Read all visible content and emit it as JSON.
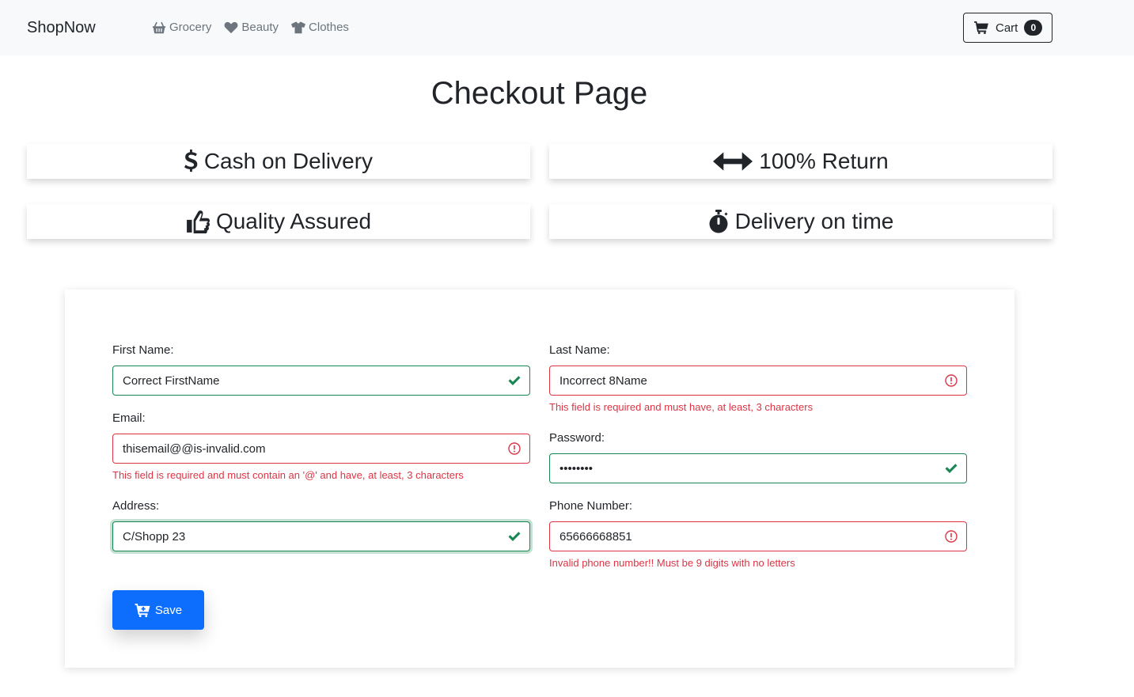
{
  "navbar": {
    "brand": "ShopNow",
    "links": [
      {
        "label": "Grocery",
        "icon": "basket-icon"
      },
      {
        "label": "Beauty",
        "icon": "heart-icon"
      },
      {
        "label": "Clothes",
        "icon": "shirt-icon"
      }
    ],
    "cart": {
      "label": "Cart",
      "count": "0",
      "icon": "cart-icon"
    }
  },
  "page": {
    "title": "Checkout Page"
  },
  "features": [
    {
      "label": "Cash on Delivery",
      "icon": "dollar-icon"
    },
    {
      "label": "100% Return",
      "icon": "arrows-horizontal-icon"
    },
    {
      "label": "Quality Assured",
      "icon": "thumbs-up-icon"
    },
    {
      "label": "Delivery on time",
      "icon": "stopwatch-icon"
    }
  ],
  "form": {
    "first_name": {
      "label": "First Name:",
      "value": "Correct FirstName",
      "state": "valid"
    },
    "last_name": {
      "label": "Last Name:",
      "value": "Incorrect 8Name",
      "state": "invalid",
      "error": "This field is required and must have, at least, 3 characters"
    },
    "email": {
      "label": "Email:",
      "value": "thisemail@@is-invalid.com",
      "state": "invalid",
      "error": "This field is required and must contain an '@' and have, at least, 3 characters"
    },
    "password": {
      "label": "Password:",
      "value": "••••••••",
      "state": "valid"
    },
    "address": {
      "label": "Address:",
      "value": "C/Shopp 23",
      "state": "valid"
    },
    "phone": {
      "label": "Phone Number:",
      "value": "65666668851",
      "state": "invalid",
      "error": "Invalid phone number!! Must be 9 digits with no letters"
    },
    "save_label": "Save"
  },
  "colors": {
    "valid": "#198754",
    "invalid": "#dc3545",
    "primary": "#0d6efd",
    "navbar_bg": "#f8f9fa"
  }
}
